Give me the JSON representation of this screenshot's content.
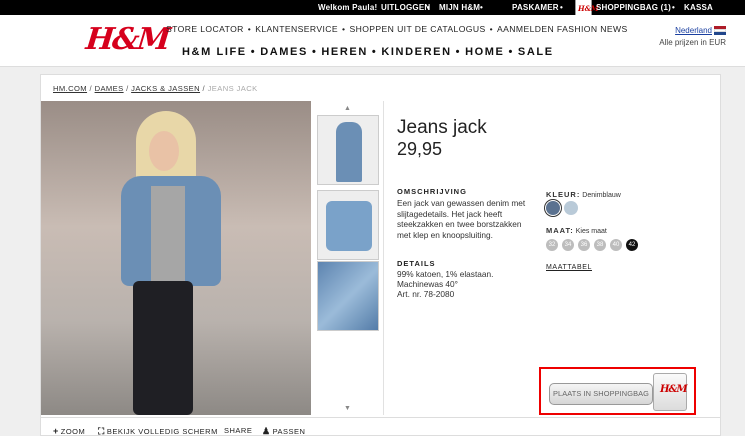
{
  "topbar": {
    "welcome": "Welkom Paula!",
    "logout": "UITLOGGEN",
    "my_hm": "MIJN H&M",
    "fitting_room": "PASKAMER",
    "bag": "SHOPPINGBAG (1)",
    "checkout": "KASSA"
  },
  "header": {
    "logo": "H&M",
    "subnav": [
      "STORE LOCATOR",
      "KLANTENSERVICE",
      "SHOPPEN UIT DE CATALOGUS",
      "AANMELDEN FASHION NEWS"
    ],
    "mainnav": [
      "H&M LIFE",
      "DAMES",
      "HEREN",
      "KINDEREN",
      "HOME",
      "SALE"
    ],
    "country": "Nederland",
    "prices_note": "Alle prijzen in EUR"
  },
  "breadcrumb": {
    "items": [
      "HM.COM",
      "DAMES",
      "JACKS & JASSEN"
    ],
    "current": "JEANS JACK"
  },
  "product": {
    "title": "Jeans jack",
    "price": "29,95",
    "description_label": "OMSCHRIJVING",
    "description": "Een jack van gewassen denim met slijtagedetails. Het jack heeft steekzakken en twee borstzakken met klep en knoopsluiting.",
    "details_label": "DETAILS",
    "details": [
      "99% katoen, 1% elastaan.",
      "Machinewas 40°",
      "Art. nr. 78-2080"
    ],
    "color_label": "KLEUR:",
    "color_value": "Denimblauw",
    "colors": [
      "#5b7290",
      "#b9cad8"
    ],
    "size_label": "MAAT:",
    "size_hint": "Kies maat",
    "sizes": [
      "32",
      "34",
      "36",
      "38",
      "40",
      "42"
    ],
    "size_guide": "MAATTABEL",
    "add_to_bag": "PLAATS IN SHOPPINGBAG"
  },
  "bottombar": {
    "zoom": "ZOOM",
    "fullscreen": "BEKIJK VOLLEDIG SCHERM",
    "share": "SHARE",
    "fit": "PASSEN"
  }
}
